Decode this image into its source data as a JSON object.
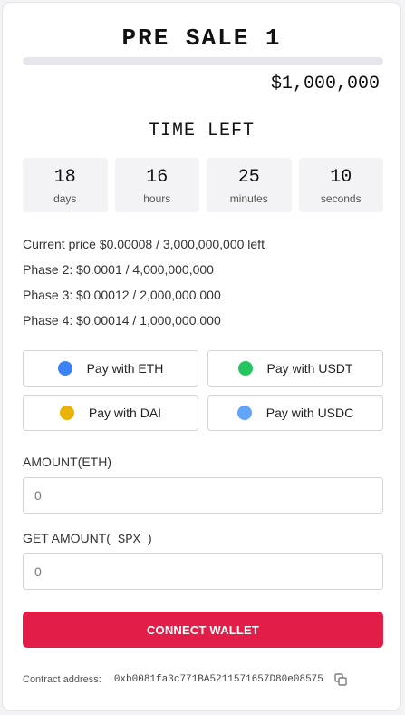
{
  "sale": {
    "title": "PRE SALE 1",
    "progress_fraction": 0,
    "goal": "$1,000,000"
  },
  "timer": {
    "heading": "TIME LEFT",
    "units": [
      {
        "value": "18",
        "label": "days"
      },
      {
        "value": "16",
        "label": "hours"
      },
      {
        "value": "25",
        "label": "minutes"
      },
      {
        "value": "10",
        "label": "seconds"
      }
    ]
  },
  "phases": [
    "Current price $0.00008 / 3,000,000,000 left",
    "Phase 2: $0.0001 / 4,000,000,000",
    "Phase 3: $0.00012 / 2,000,000,000",
    "Phase 4: $0.00014 / 1,000,000,000"
  ],
  "pay_options": [
    {
      "label": "Pay with ETH",
      "color": "#3b82f6"
    },
    {
      "label": "Pay with USDT",
      "color": "#22c55e"
    },
    {
      "label": "Pay with DAI",
      "color": "#eab308"
    },
    {
      "label": "Pay with USDC",
      "color": "#60a5fa"
    }
  ],
  "amount": {
    "label": "AMOUNT(ETH)",
    "placeholder": "0"
  },
  "get_amount": {
    "label": "GET AMOUNT(",
    "token": "SPX",
    "label_close": ")",
    "placeholder": "0"
  },
  "connect_label": "CONNECT WALLET",
  "contract": {
    "label": "Contract address:",
    "address": "0xb0081fa3c771BA5211571657D80e08575",
    "copy_icon": "copy-icon"
  },
  "colors": {
    "accent": "#e11d48"
  }
}
